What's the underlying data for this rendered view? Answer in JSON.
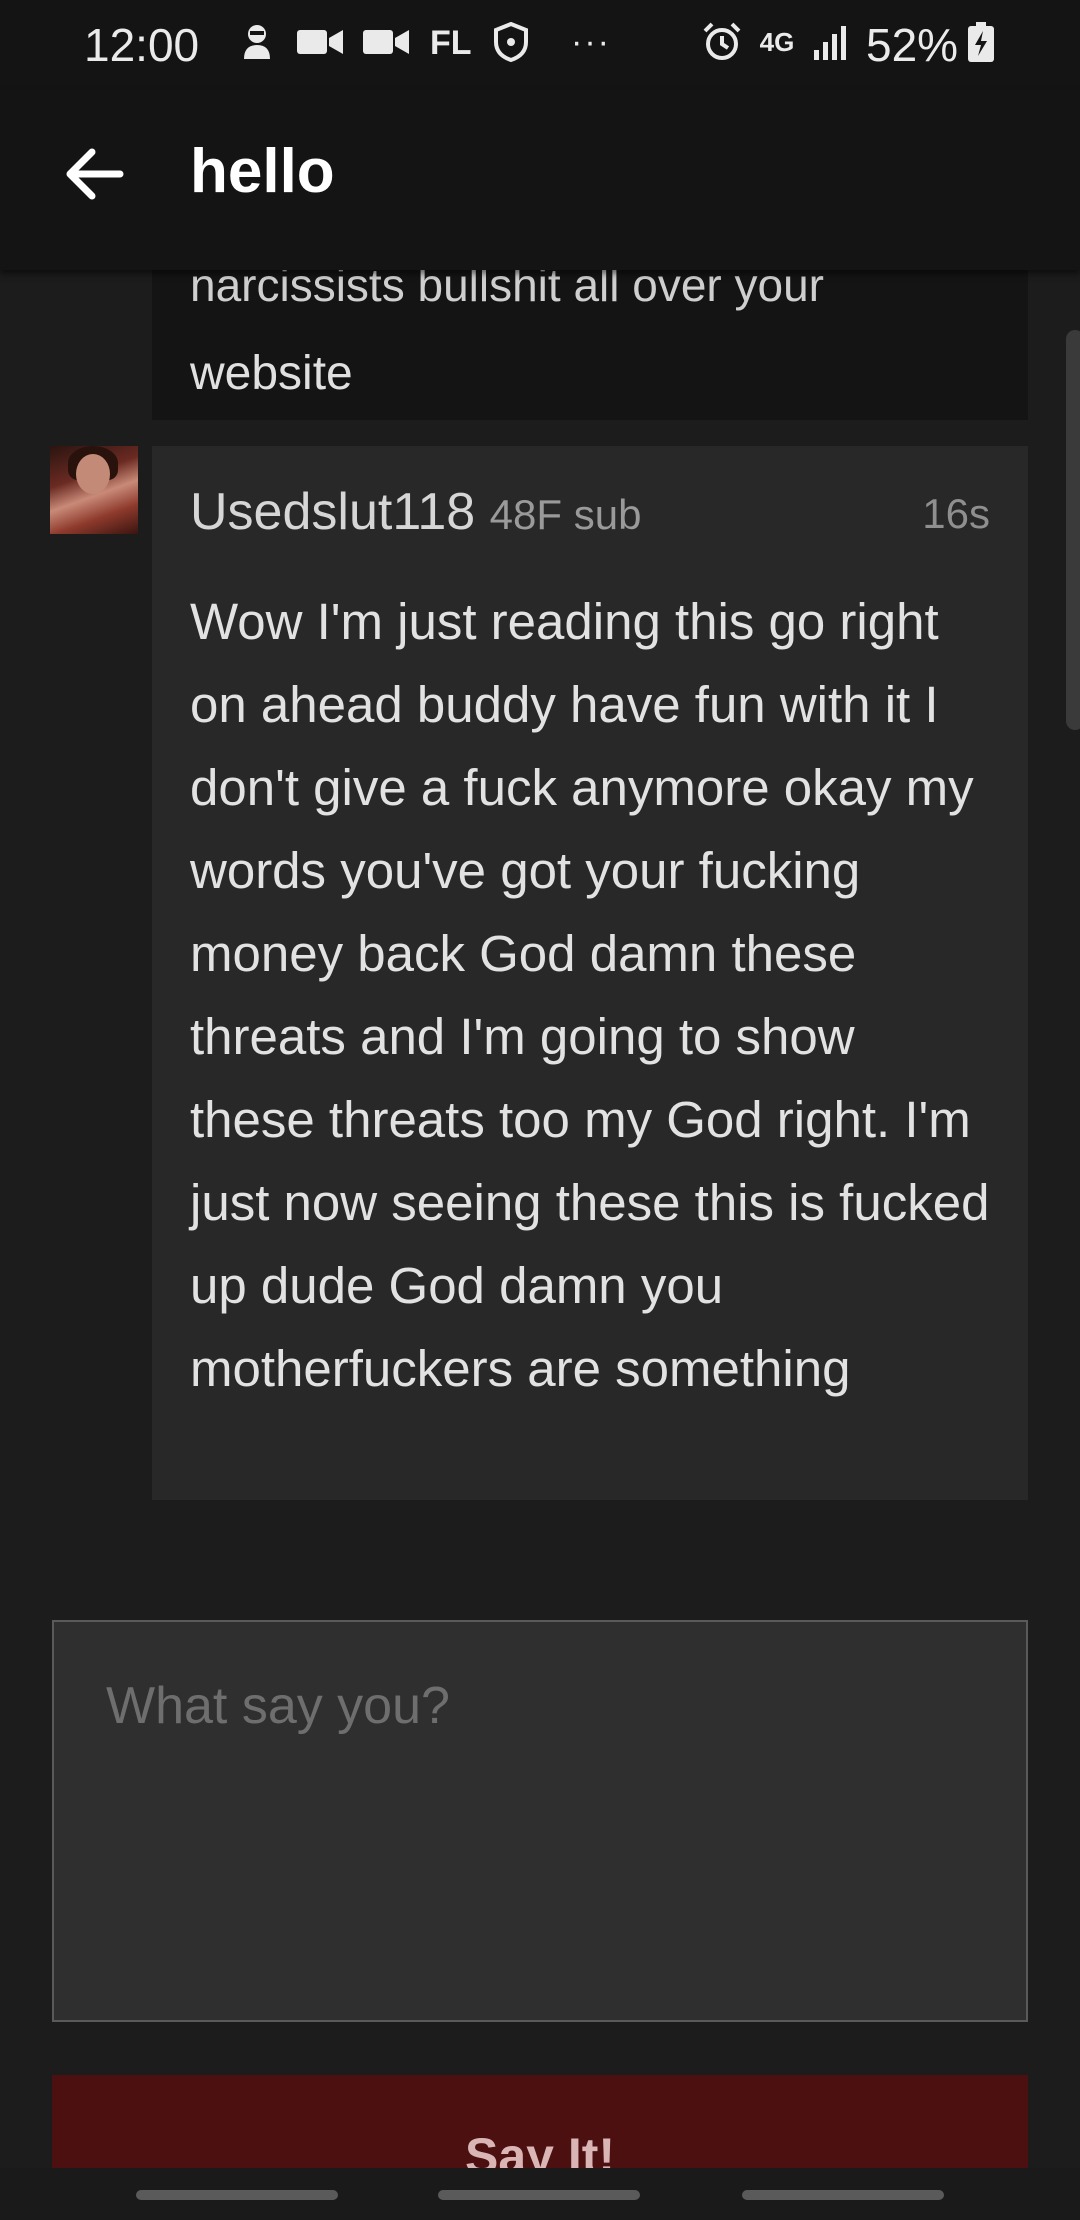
{
  "status_bar": {
    "time": "12:00",
    "carrier": "FL",
    "more": "···",
    "network": "4G",
    "battery": "52%",
    "icons": [
      "account-icon",
      "video-icon",
      "video-icon",
      "shield-icon",
      "alarm-icon",
      "network-icon",
      "signal-icon",
      "battery-icon"
    ]
  },
  "header": {
    "title": "hello",
    "back_icon": "back-arrow-icon"
  },
  "previous_message": {
    "cut_line": "narcissists bullshit all over your",
    "last_line": "website"
  },
  "message": {
    "username": "Usedslut118",
    "meta": "48F sub",
    "time": "16s",
    "body": "Wow I'm just reading this go right on ahead buddy have fun with it I don't give a fuck anymore okay my words you've got your fucking money back God damn these threats and I'm going to show these threats too my God right. I'm just now seeing these this is fucked up dude God damn you motherfuckers are something"
  },
  "composer": {
    "placeholder": "What say you?",
    "value": ""
  },
  "actions": {
    "submit_label": "Say It!"
  },
  "colors": {
    "background": "#1c1c1c",
    "header": "#141414",
    "bubble": "#282828",
    "button": "#4c1010"
  }
}
